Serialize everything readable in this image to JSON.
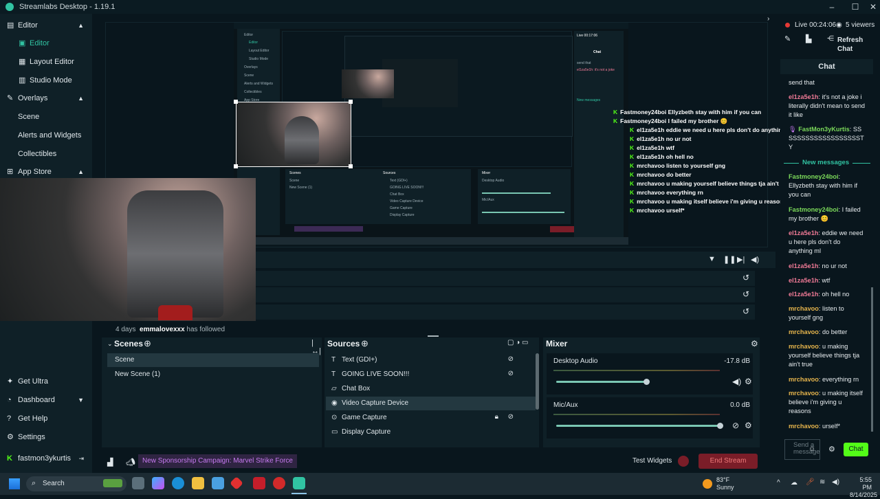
{
  "titlebar": {
    "title": "Streamlabs Desktop - 1.19.1"
  },
  "nav": {
    "editor": "Editor",
    "editor_sub": "Editor",
    "layout_editor": "Layout Editor",
    "studio_mode": "Studio Mode",
    "overlays": "Overlays",
    "scene": "Scene",
    "alerts": "Alerts and Widgets",
    "collectibles": "Collectibles",
    "app_store": "App Store",
    "get_ultra": "Get Ultra",
    "dashboard": "Dashboard",
    "get_help": "Get Help",
    "settings": "Settings",
    "user": "fastmon3ykurtis"
  },
  "overlay_chat": [
    {
      "user": "Fastmoney24boi",
      "text": "Ellyzbeth stay with him if you can"
    },
    {
      "user": "Fastmoney24boi",
      "text": "I failed my brother 😊"
    },
    {
      "user": "el1za5e1h",
      "text": "eddie we need u here pls don't do anything ml"
    },
    {
      "user": "el1za5e1h",
      "text": "no ur not"
    },
    {
      "user": "el1za5e1h",
      "text": "wtf"
    },
    {
      "user": "el1za5e1h",
      "text": "oh hell no"
    },
    {
      "user": "mrchavoo",
      "text": "listen to yourself gng"
    },
    {
      "user": "mrchavoo",
      "text": "do better"
    },
    {
      "user": "mrchavoo",
      "text": "u making yourself believe things tja ain't true"
    },
    {
      "user": "mrchavoo",
      "text": "everything rn"
    },
    {
      "user": "mrchavoo",
      "text": "u making itself believe i'm giving u reasons"
    },
    {
      "user": "mrchavoo",
      "text": "urself*"
    }
  ],
  "events": {
    "follow_ago": "4 days",
    "follow_user": "emmalovexxx",
    "follow_text": "has followed"
  },
  "scenes": {
    "title": "Scenes",
    "items": [
      "Scene",
      "New Scene (1)"
    ]
  },
  "sources": {
    "title": "Sources",
    "items": [
      "Text (GDI+)",
      "GOING LIVE SOON!!!",
      "Chat Box",
      "Video Capture Device",
      "Game Capture",
      "Display Capture"
    ]
  },
  "mixer": {
    "title": "Mixer",
    "channels": [
      {
        "name": "Desktop Audio",
        "db": "-17.8 dB",
        "level": 0.55
      },
      {
        "name": "Mic/Aux",
        "db": "0.0 dB",
        "level": 1.0
      }
    ]
  },
  "statusbar": {
    "campaign": "New Sponsorship Campaign: Marvel Strike Force",
    "test_widgets": "Test Widgets",
    "end_stream": "End Stream"
  },
  "live": {
    "status": "Live",
    "time": "00:24:06",
    "viewers": "5 viewers",
    "refresh": "Refresh",
    "refresh2": "Chat"
  },
  "chat": {
    "title": "Chat",
    "new_messages": "New messages",
    "input_placeholder": "Send a message",
    "send": "Chat",
    "messages": [
      {
        "user": "",
        "text": "send that",
        "color": "none"
      },
      {
        "user": "el1za5e1h",
        "text": "it's not a joke i literally didn't mean to send it like",
        "color": "red"
      },
      {
        "user": "FastMon3yKurtis",
        "text": "SSSSSSSSSSSSSSSSSSSTY",
        "color": "green"
      },
      {
        "user": "Fastmoney24boi",
        "text": "Ellyzbeth stay with him if you can",
        "color": "green"
      },
      {
        "user": "Fastmoney24boi",
        "text": "I failed my brother 😊",
        "color": "green"
      },
      {
        "user": "el1za5e1h",
        "text": "eddie we need u here pls don't do anything ml",
        "color": "red"
      },
      {
        "user": "el1za5e1h",
        "text": "no ur not",
        "color": "red"
      },
      {
        "user": "el1za5e1h",
        "text": "wtf",
        "color": "red"
      },
      {
        "user": "el1za5e1h",
        "text": "oh hell no",
        "color": "red"
      },
      {
        "user": "mrchavoo",
        "text": "listen to yourself gng",
        "color": "yel"
      },
      {
        "user": "mrchavoo",
        "text": "do better",
        "color": "yel"
      },
      {
        "user": "mrchavoo",
        "text": "u making yourself believe things tja ain't true",
        "color": "yel"
      },
      {
        "user": "mrchavoo",
        "text": "everything rn",
        "color": "yel"
      },
      {
        "user": "mrchavoo",
        "text": "u making itself believe i'm giving u reasons",
        "color": "yel"
      },
      {
        "user": "mrchavoo",
        "text": "urself*",
        "color": "yel"
      }
    ]
  },
  "taskbar": {
    "search": "Search",
    "temp": "83°F",
    "weather": "Sunny",
    "time": "5:55 PM",
    "date": "8/14/2025"
  },
  "colors": {
    "accent": "#31c3a2",
    "live_red": "#e53935",
    "kick_green": "#53fc18",
    "end_stream": "#7a1d28"
  }
}
